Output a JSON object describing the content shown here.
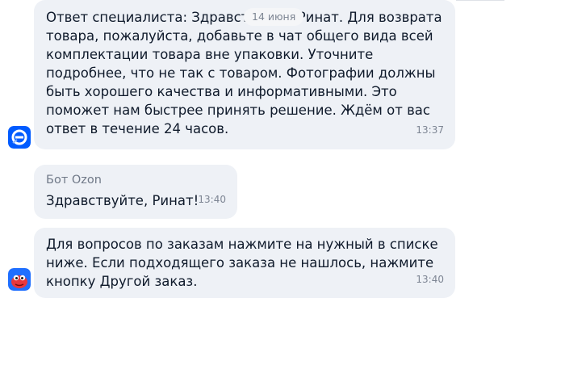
{
  "date_chip": "14 июня",
  "messages": [
    {
      "sender": "",
      "text": "Ответ специалиста: Здравствуйте, Ринат. Для возврата\nтовара, пожалуйста, добавьте в чат общего вида всей\nкомплектации товара вне упаковки. Уточните\nподробнее, что не так с товаром. Фотографии должны\nбыть хорошего качества и информативными. Это\nпоможет нам быстрее принять решение. Ждём от вас\nответ в течение 24 часов.",
      "time": "13:37",
      "avatar": "ozon-logo-icon"
    },
    {
      "sender": "Бот Ozon",
      "text": "Здравствуйте, Ринат!",
      "time": "13:40",
      "avatar": ""
    },
    {
      "sender": "",
      "text": "Для вопросов по заказам нажмите на нужный в списке\nниже. Если подходящего заказа не нашлось, нажмите\nкнопку Другой заказ.",
      "time": "13:40",
      "avatar": "ozon-bot-icon"
    }
  ],
  "colors": {
    "bubble": "#eef1f6",
    "ozon_blue": "#005bff",
    "bot_red": "#e8383d"
  }
}
